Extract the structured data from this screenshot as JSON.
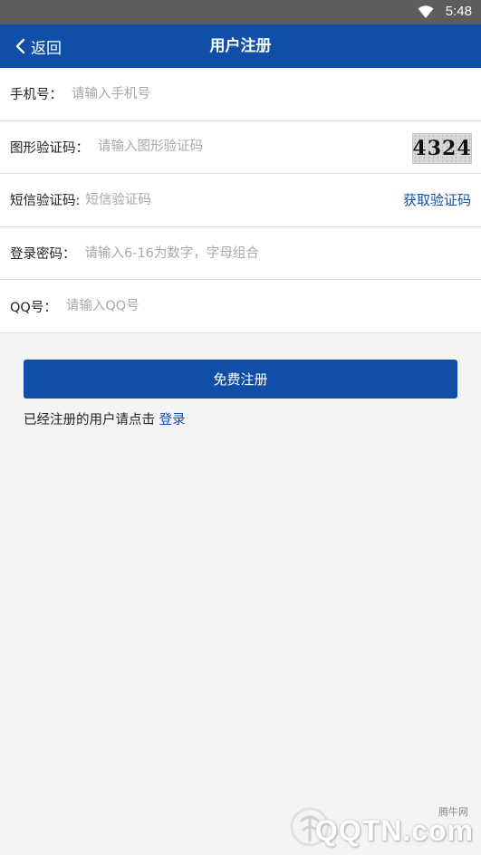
{
  "status_bar": {
    "time": "5:48"
  },
  "header": {
    "back_label": "返回",
    "title": "用户注册"
  },
  "form": {
    "phone": {
      "label": "手机号：",
      "placeholder": "请输入手机号"
    },
    "captcha": {
      "label": "图形验证码：",
      "placeholder": "请输入图形验证码",
      "image_text": "4324"
    },
    "sms": {
      "label": "短信验证码:",
      "placeholder": "短信验证码",
      "get_code_label": "获取验证码"
    },
    "password": {
      "label": "登录密码：",
      "placeholder": "请输入6-16为数字，字母组合"
    },
    "qq": {
      "label": "QQ号：",
      "placeholder": "请输入QQ号"
    }
  },
  "submit_label": "免费注册",
  "login_hint": {
    "text": "已经注册的用户请点击 ",
    "link": "登录"
  },
  "watermark": {
    "cn": "腾牛网",
    "en": "QQTN.com"
  },
  "colors": {
    "primary": "#0f4fa8",
    "status_bar": "#5d5d5d",
    "background": "#f4f4f4"
  }
}
